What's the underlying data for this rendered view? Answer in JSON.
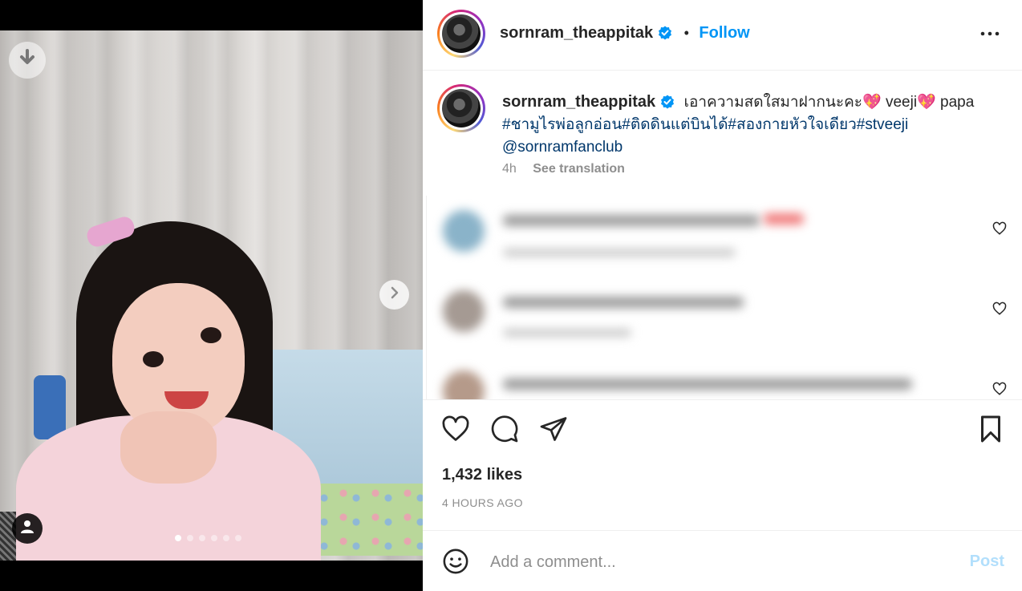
{
  "post": {
    "username": "sornram_theappitak",
    "follow_label": "Follow",
    "separator": "•",
    "caption": {
      "text_part1": "เอาความสดใสมาฝากนะคะ",
      "heart1": "💖",
      "text_part2": "veeji",
      "heart2": "💖",
      "text_part3": "papa",
      "hashtags": "#ชามูไรพ่อลูกอ่อน#ติดดินแต่บินได้#สองกายหัวใจเดียว#stveeji",
      "mention": "@sornramfanclub"
    },
    "age": "4h",
    "see_translation": "See translation",
    "likes": "1,432 likes",
    "time_ago": "4 HOURS AGO"
  },
  "carousel": {
    "slide_count": 6,
    "active_index": 0
  },
  "comment_input": {
    "placeholder": "Add a comment...",
    "post_label": "Post"
  },
  "colors": {
    "accent_blue": "#0095f6",
    "hashtag_blue": "#00376b",
    "post_disabled": "#b2dffc",
    "secondary_text": "#8e8e8e"
  },
  "icons": {
    "download": "download-icon",
    "next": "chevron-right-icon",
    "tagged_user": "user-icon",
    "verified": "verified-badge-icon",
    "more": "more-options-icon",
    "like": "heart-icon",
    "comment": "comment-icon",
    "share": "send-icon",
    "save": "bookmark-icon",
    "emoji": "emoji-icon"
  }
}
